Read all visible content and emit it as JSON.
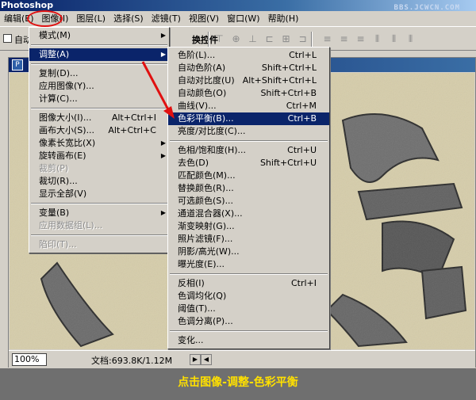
{
  "app": {
    "title": "Photoshop",
    "watermark": "BBS.JCWCN.COM"
  },
  "menubar": [
    {
      "label": "编辑(E)"
    },
    {
      "label": "图像(I)"
    },
    {
      "label": "图层(L)"
    },
    {
      "label": "选择(S)"
    },
    {
      "label": "滤镜(T)"
    },
    {
      "label": "视图(V)"
    },
    {
      "label": "窗口(W)"
    },
    {
      "label": "帮助(H)"
    }
  ],
  "options_bar": {
    "auto_select_label": "自动",
    "partial_label": "换控件",
    "align_icons": [
      "align-top-icon",
      "align-vcenter-icon",
      "align-bottom-icon",
      "align-left-icon",
      "align-hcenter-icon",
      "align-right-icon",
      "distribute-top-icon",
      "distribute-vcenter-icon",
      "distribute-bottom-icon",
      "distribute-left-icon",
      "distribute-hcenter-icon",
      "distribute-right-icon"
    ]
  },
  "image_menu": {
    "items": [
      {
        "label": "模式(M)",
        "shortcut": "",
        "submenu": true,
        "disabled": false,
        "highlight": false
      },
      {
        "sep": true
      },
      {
        "label": "调整(A)",
        "shortcut": "",
        "submenu": true,
        "disabled": false,
        "highlight": true
      },
      {
        "sep": true
      },
      {
        "label": "复制(D)...",
        "shortcut": "",
        "submenu": false,
        "disabled": false,
        "highlight": false
      },
      {
        "label": "应用图像(Y)...",
        "shortcut": "",
        "submenu": false,
        "disabled": false,
        "highlight": false
      },
      {
        "label": "计算(C)...",
        "shortcut": "",
        "submenu": false,
        "disabled": false,
        "highlight": false
      },
      {
        "sep": true
      },
      {
        "label": "图像大小(I)...",
        "shortcut": "Alt+Ctrl+I",
        "submenu": false,
        "disabled": false,
        "highlight": false
      },
      {
        "label": "画布大小(S)...",
        "shortcut": "Alt+Ctrl+C",
        "submenu": false,
        "disabled": false,
        "highlight": false
      },
      {
        "label": "像素长宽比(X)",
        "shortcut": "",
        "submenu": true,
        "disabled": false,
        "highlight": false
      },
      {
        "label": "旋转画布(E)",
        "shortcut": "",
        "submenu": true,
        "disabled": false,
        "highlight": false
      },
      {
        "label": "裁剪(P)",
        "shortcut": "",
        "submenu": false,
        "disabled": true,
        "highlight": false
      },
      {
        "label": "裁切(R)...",
        "shortcut": "",
        "submenu": false,
        "disabled": false,
        "highlight": false
      },
      {
        "label": "显示全部(V)",
        "shortcut": "",
        "submenu": false,
        "disabled": false,
        "highlight": false
      },
      {
        "sep": true
      },
      {
        "label": "变量(B)",
        "shortcut": "",
        "submenu": true,
        "disabled": false,
        "highlight": false
      },
      {
        "label": "应用数据组(L)...",
        "shortcut": "",
        "submenu": false,
        "disabled": true,
        "highlight": false
      },
      {
        "sep": true
      },
      {
        "label": "陷印(T)...",
        "shortcut": "",
        "submenu": false,
        "disabled": true,
        "highlight": false
      }
    ]
  },
  "adjust_menu": {
    "items": [
      {
        "label": "色阶(L)...",
        "shortcut": "Ctrl+L",
        "highlight": false
      },
      {
        "label": "自动色阶(A)",
        "shortcut": "Shift+Ctrl+L",
        "highlight": false
      },
      {
        "label": "自动对比度(U)",
        "shortcut": "Alt+Shift+Ctrl+L",
        "highlight": false
      },
      {
        "label": "自动颜色(O)",
        "shortcut": "Shift+Ctrl+B",
        "highlight": false
      },
      {
        "label": "曲线(V)...",
        "shortcut": "Ctrl+M",
        "highlight": false
      },
      {
        "label": "色彩平衡(B)...",
        "shortcut": "Ctrl+B",
        "highlight": true
      },
      {
        "label": "亮度/对比度(C)...",
        "shortcut": "",
        "highlight": false
      },
      {
        "sep": true
      },
      {
        "label": "色相/饱和度(H)...",
        "shortcut": "Ctrl+U",
        "highlight": false
      },
      {
        "label": "去色(D)",
        "shortcut": "Shift+Ctrl+U",
        "highlight": false
      },
      {
        "label": "匹配颜色(M)...",
        "shortcut": "",
        "highlight": false
      },
      {
        "label": "替换颜色(R)...",
        "shortcut": "",
        "highlight": false
      },
      {
        "label": "可选颜色(S)...",
        "shortcut": "",
        "highlight": false
      },
      {
        "label": "通道混合器(X)...",
        "shortcut": "",
        "highlight": false
      },
      {
        "label": "渐变映射(G)...",
        "shortcut": "",
        "highlight": false
      },
      {
        "label": "照片滤镜(F)...",
        "shortcut": "",
        "highlight": false
      },
      {
        "label": "阴影/高光(W)...",
        "shortcut": "",
        "highlight": false
      },
      {
        "label": "曝光度(E)...",
        "shortcut": "",
        "highlight": false
      },
      {
        "sep": true
      },
      {
        "label": "反相(I)",
        "shortcut": "Ctrl+I",
        "highlight": false
      },
      {
        "label": "色调均化(Q)",
        "shortcut": "",
        "highlight": false
      },
      {
        "label": "阈值(T)...",
        "shortcut": "",
        "highlight": false
      },
      {
        "label": "色调分离(P)...",
        "shortcut": "",
        "highlight": false
      },
      {
        "sep": true
      },
      {
        "label": "变化...",
        "shortcut": "",
        "highlight": false
      }
    ]
  },
  "status": {
    "zoom": "100%",
    "doc_size": "文档:693.8K/1.12M"
  },
  "caption": "点击图像-调整-色彩平衡",
  "colors": {
    "highlight": "#0a246a",
    "arrow": "#e01010",
    "caption": "#ffe000",
    "canvas": "#d6cdaa"
  }
}
